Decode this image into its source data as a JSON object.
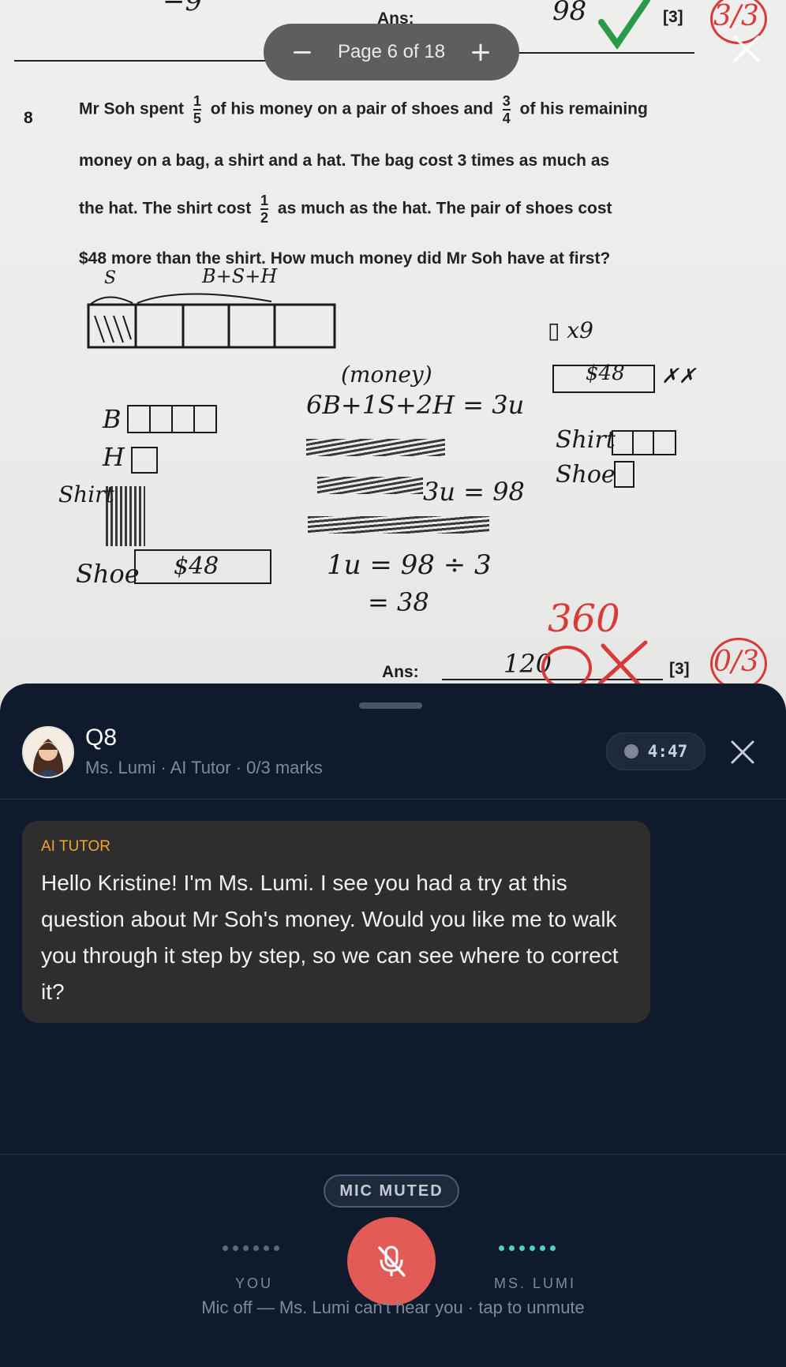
{
  "worksheet": {
    "pager": {
      "label": "Page 6 of 18",
      "minus": "−",
      "plus": "+"
    },
    "prev_answer": {
      "ans_label": "Ans:",
      "value": "98",
      "marks": "[3]",
      "score": "3/3"
    },
    "question": {
      "number": "8",
      "line1_a": "Mr Soh spent",
      "frac1": {
        "num": "1",
        "den": "5"
      },
      "line1_b": "of his money on a pair of shoes and",
      "frac2": {
        "num": "3",
        "den": "4"
      },
      "line1_c": "of his remaining",
      "line2": "money on a bag, a shirt and a hat.   The bag cost 3 times as much as",
      "line3_a": "the hat.   The shirt cost",
      "frac3": {
        "num": "1",
        "den": "2"
      },
      "line3_b": "as much as the hat.   The pair of shoes cost",
      "line4": "$48 more than the shirt.   How much money did Mr Soh have at first?"
    },
    "working": {
      "s": "S",
      "bsh": "B+S+H",
      "x9": "▯ x9",
      "box48": "$48",
      "money": "(money)",
      "eq1": "6B+1S+2H = 3u",
      "b": "B",
      "h": "H",
      "shirt_a": "Shirt",
      "shoe_a": "Shoe",
      "shoe_box": "$48",
      "shirt_b": "Shirt",
      "shoe_b": "Shoe",
      "eq2": "3u = 98",
      "eq3": "1u = 98 ÷ 3",
      "eq4": "= 38"
    },
    "answer": {
      "ans_label": "Ans:",
      "value": "120",
      "correction": "360",
      "marks": "[3]",
      "score": "0/3"
    }
  },
  "panel": {
    "title": "Q8",
    "subtitle": "Ms. Lumi · AI Tutor · 0/3 marks",
    "timer": "4:47",
    "message": {
      "tag": "AI TUTOR",
      "text": "Hello Kristine! I'm Ms. Lumi. I see you had a try at this question about Mr Soh's money. Would you like me to walk you through it step by step, so we can see where to correct it?"
    },
    "mic_status": "MIC MUTED",
    "you_label": "YOU",
    "tutor_label": "MS. LUMI",
    "hint": "Mic off — Ms. Lumi can't hear you · tap to unmute",
    "colors": {
      "accent_red": "#e35b56",
      "tutor_dots": "#4fd1c5",
      "tag": "#f4a52a"
    }
  }
}
